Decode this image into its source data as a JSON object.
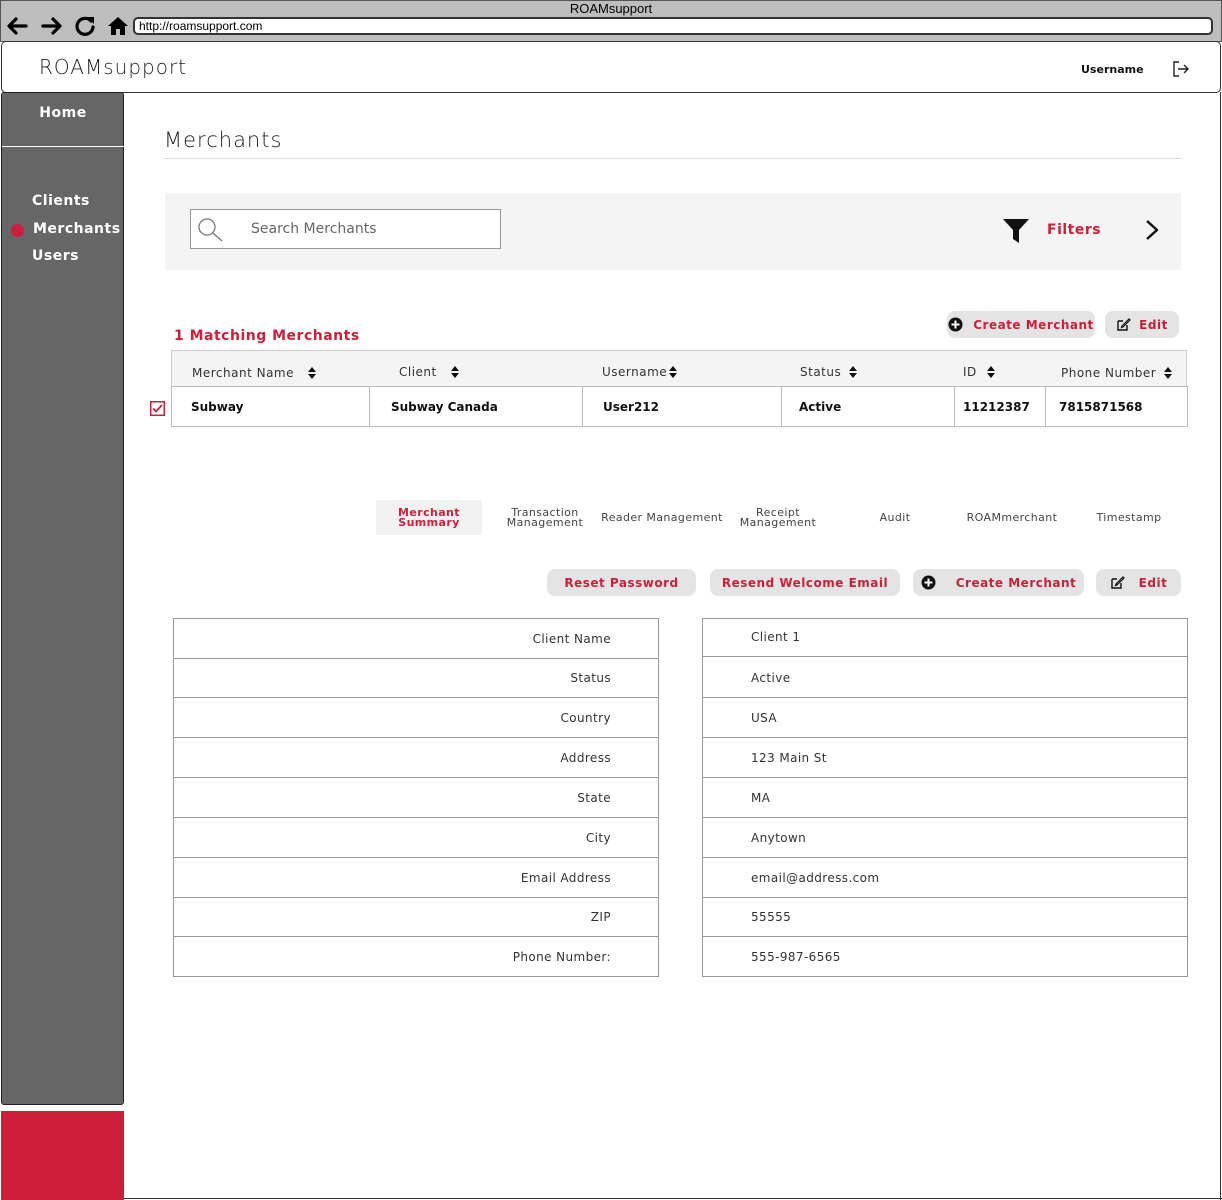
{
  "browser": {
    "title": "ROAMsupport",
    "url": "http://roamsupport.com"
  },
  "header": {
    "brand": "ROAMsupport",
    "username": "Username"
  },
  "sidebar": {
    "home": "Home",
    "items": [
      {
        "label": "Clients",
        "active": false
      },
      {
        "label": "Merchants",
        "active": true
      },
      {
        "label": "Users",
        "active": false
      }
    ]
  },
  "page": {
    "title": "Merchants"
  },
  "search": {
    "placeholder": "Search Merchants",
    "filters_label": "Filters"
  },
  "results": {
    "count_label": "1 Matching Merchants",
    "create_label": "Create Merchant",
    "edit_label": "Edit",
    "columns": [
      "Merchant Name",
      "Client",
      "Username",
      "Status",
      "ID",
      "Phone Number"
    ],
    "rows": [
      {
        "merchant_name": "Subway",
        "client": "Subway Canada",
        "username": "User212",
        "status": "Active",
        "id": "11212387",
        "phone": "7815871568",
        "selected": true
      }
    ]
  },
  "tabs": [
    {
      "label": "Merchant Summary",
      "active": true
    },
    {
      "label": "Transaction Management",
      "active": false
    },
    {
      "label": "Reader Management",
      "active": false
    },
    {
      "label": "Receipt Management",
      "active": false
    },
    {
      "label": "Audit",
      "active": false
    },
    {
      "label": "ROAMmerchant",
      "active": false
    },
    {
      "label": "Timestamp",
      "active": false
    }
  ],
  "actions": {
    "reset_password": "Reset Password",
    "resend_welcome": "Resend Welcome Email",
    "create_merchant": "Create Merchant",
    "edit": "Edit"
  },
  "details": [
    {
      "label": "Client Name",
      "value": "Client 1"
    },
    {
      "label": "Status",
      "value": "Active"
    },
    {
      "label": "Country",
      "value": "USA"
    },
    {
      "label": "Address",
      "value": "123 Main St"
    },
    {
      "label": "State",
      "value": "MA"
    },
    {
      "label": "City",
      "value": "Anytown"
    },
    {
      "label": "Email Address",
      "value": "email@address.com"
    },
    {
      "label": "ZIP",
      "value": "55555"
    },
    {
      "label": "Phone Number:",
      "value": "555-987-6565"
    }
  ],
  "colors": {
    "accent": "#cc1f3a",
    "sidebar": "#666666",
    "panel": "#f4f4f4",
    "button": "#e4e4e4"
  },
  "icons": {
    "back": "arrow-left-icon",
    "forward": "arrow-right-icon",
    "reload": "reload-icon",
    "home": "home-icon",
    "logout": "logout-icon",
    "search": "search-icon",
    "filter": "filter-icon",
    "chevron": "chevron-right-icon",
    "add": "plus-circle-icon",
    "edit": "edit-icon",
    "sort": "sort-icon",
    "checkbox": "checkbox-checked-icon"
  }
}
